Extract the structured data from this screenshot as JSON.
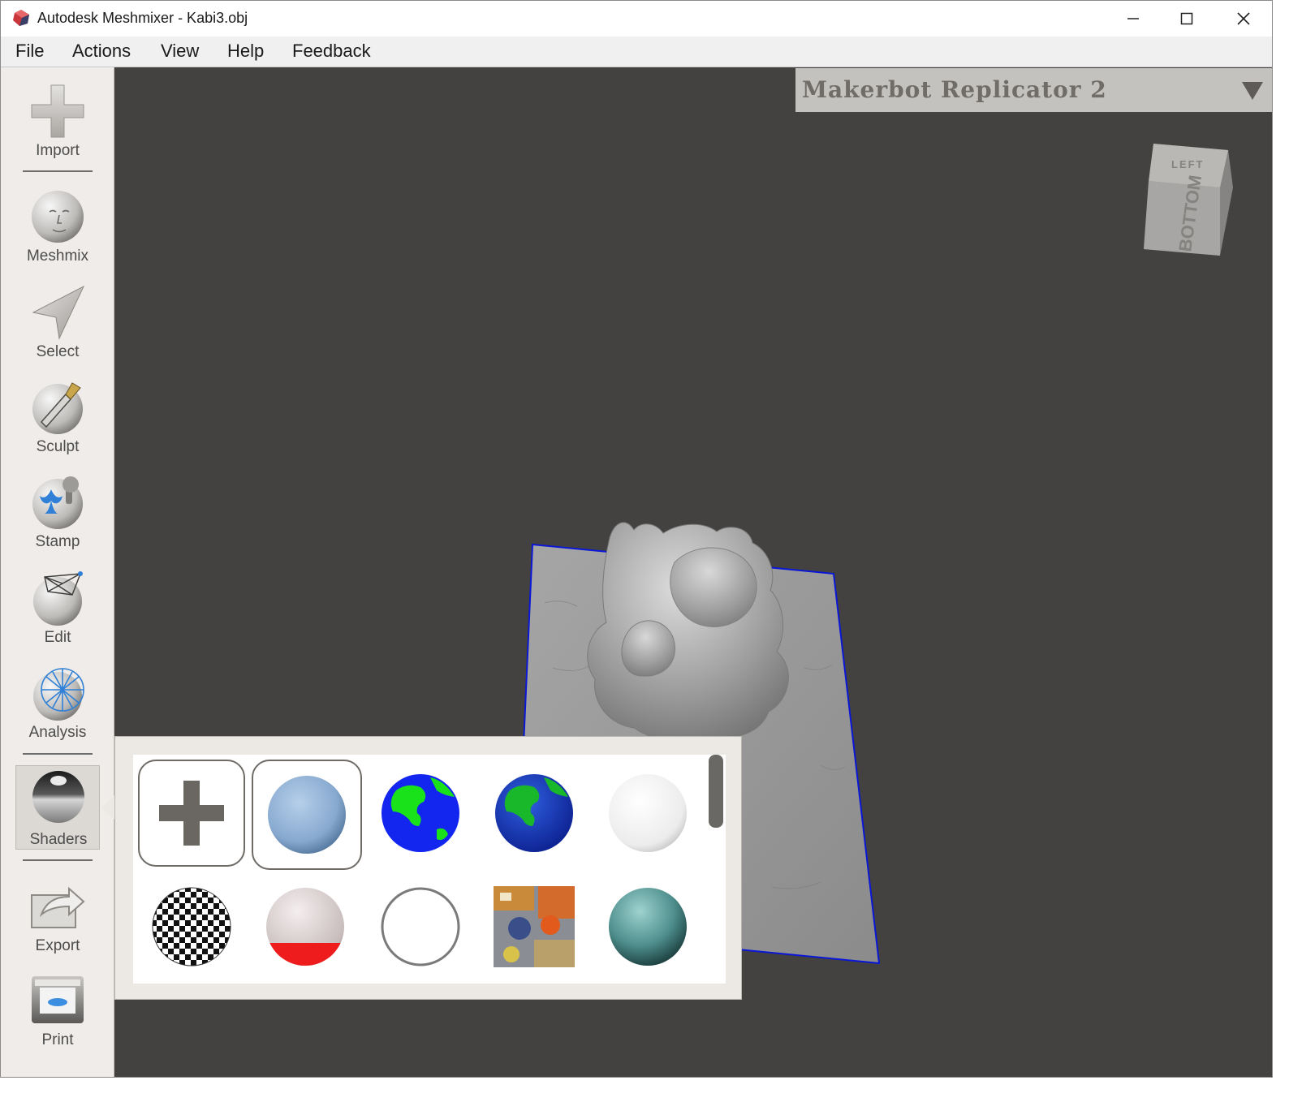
{
  "window": {
    "title": "Autodesk Meshmixer - Kabi3.obj"
  },
  "menu": [
    "File",
    "Actions",
    "View",
    "Help",
    "Feedback"
  ],
  "toolbar": {
    "items": [
      {
        "label": "Import",
        "icon": "import-plus-icon"
      },
      {
        "label": "Meshmix",
        "icon": "meshmix-face-sphere-icon"
      },
      {
        "label": "Select",
        "icon": "select-arrow-icon"
      },
      {
        "label": "Sculpt",
        "icon": "sculpt-brush-icon"
      },
      {
        "label": "Stamp",
        "icon": "stamp-fleur-icon"
      },
      {
        "label": "Edit",
        "icon": "edit-wireframe-icon"
      },
      {
        "label": "Analysis",
        "icon": "analysis-mesh-sphere-icon"
      },
      {
        "label": "Shaders",
        "icon": "shaders-chrome-sphere-icon",
        "active": true
      },
      {
        "label": "Export",
        "icon": "export-arrow-icon"
      },
      {
        "label": "Print",
        "icon": "print-printer-icon"
      }
    ]
  },
  "printer": {
    "selected": "Makerbot Replicator 2"
  },
  "viewcube": {
    "top_face": "LEFT",
    "front_face": "BOTTOM"
  },
  "shaders": [
    {
      "name": "add-shader",
      "kind": "add"
    },
    {
      "name": "blue-matte",
      "kind": "sphere",
      "color": "#8fb2d6",
      "selected": true
    },
    {
      "name": "earth-1",
      "kind": "earth"
    },
    {
      "name": "earth-2",
      "kind": "earth"
    },
    {
      "name": "white-pearl",
      "kind": "sphere",
      "color": "#f2f2f2"
    },
    {
      "name": "checker",
      "kind": "checker"
    },
    {
      "name": "overhang-red",
      "kind": "overhang"
    },
    {
      "name": "white-outline",
      "kind": "outline"
    },
    {
      "name": "texture-photo",
      "kind": "photo"
    },
    {
      "name": "teal-glossy",
      "kind": "sphere",
      "color": "#5e9c9c"
    }
  ],
  "colors": {
    "viewport_bg": "#434241",
    "toolbar_bg": "#efece9",
    "mesh_border": "#0b17d6"
  }
}
